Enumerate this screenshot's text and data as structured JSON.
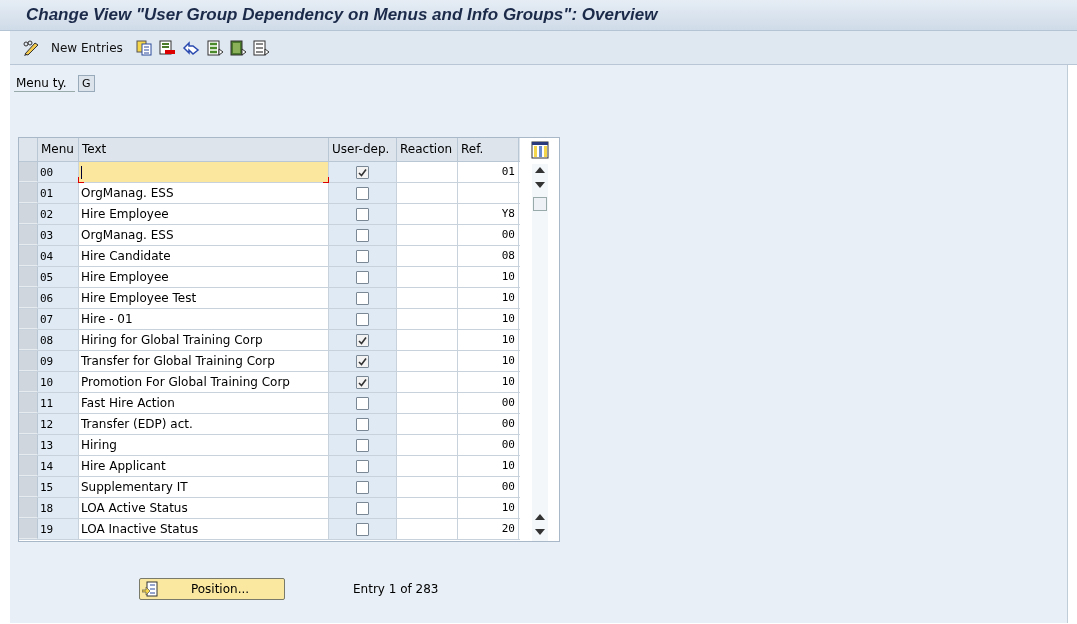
{
  "window": {
    "title": "Change View \"User Group Dependency on Menus and Info Groups\": Overview"
  },
  "toolbar": {
    "new_entries": "New Entries"
  },
  "menu_type": {
    "label": "Menu ty.",
    "value": "G"
  },
  "table": {
    "columns": [
      "Menu",
      "Text",
      "User-dep.",
      "Reaction",
      "Ref."
    ],
    "rows": [
      {
        "menu": "00",
        "text": "",
        "user_dep": true,
        "reaction": "",
        "ref": "01",
        "focused": true
      },
      {
        "menu": "01",
        "text": "OrgManag. ESS",
        "user_dep": false,
        "reaction": "",
        "ref": "",
        "focused": false
      },
      {
        "menu": "02",
        "text": "Hire Employee",
        "user_dep": false,
        "reaction": "",
        "ref": "Y8",
        "focused": false
      },
      {
        "menu": "03",
        "text": "OrgManag. ESS",
        "user_dep": false,
        "reaction": "",
        "ref": "00",
        "focused": false
      },
      {
        "menu": "04",
        "text": "Hire Candidate",
        "user_dep": false,
        "reaction": "",
        "ref": "08",
        "focused": false
      },
      {
        "menu": "05",
        "text": "Hire Employee",
        "user_dep": false,
        "reaction": "",
        "ref": "10",
        "focused": false
      },
      {
        "menu": "06",
        "text": "Hire Employee Test",
        "user_dep": false,
        "reaction": "",
        "ref": "10",
        "focused": false
      },
      {
        "menu": "07",
        "text": "Hire - 01",
        "user_dep": false,
        "reaction": "",
        "ref": "10",
        "focused": false
      },
      {
        "menu": "08",
        "text": "Hiring for Global Training Corp",
        "user_dep": true,
        "reaction": "",
        "ref": "10",
        "focused": false
      },
      {
        "menu": "09",
        "text": "Transfer for Global Training Corp",
        "user_dep": true,
        "reaction": "",
        "ref": "10",
        "focused": false
      },
      {
        "menu": "10",
        "text": "Promotion For Global Training Corp",
        "user_dep": true,
        "reaction": "",
        "ref": "10",
        "focused": false
      },
      {
        "menu": "11",
        "text": "Fast Hire Action",
        "user_dep": false,
        "reaction": "",
        "ref": "00",
        "focused": false
      },
      {
        "menu": "12",
        "text": "Transfer (EDP) act.",
        "user_dep": false,
        "reaction": "",
        "ref": "00",
        "focused": false
      },
      {
        "menu": "13",
        "text": "Hiring",
        "user_dep": false,
        "reaction": "",
        "ref": "00",
        "focused": false
      },
      {
        "menu": "14",
        "text": "Hire Applicant",
        "user_dep": false,
        "reaction": "",
        "ref": "10",
        "focused": false
      },
      {
        "menu": "15",
        "text": "Supplementary IT",
        "user_dep": false,
        "reaction": "",
        "ref": "00",
        "focused": false
      },
      {
        "menu": "18",
        "text": "LOA Active Status",
        "user_dep": false,
        "reaction": "",
        "ref": "10",
        "focused": false
      },
      {
        "menu": "19",
        "text": "LOA Inactive Status",
        "user_dep": false,
        "reaction": "",
        "ref": "20",
        "focused": false
      }
    ]
  },
  "position_button": "Position...",
  "entry_info": "Entry 1 of 283"
}
